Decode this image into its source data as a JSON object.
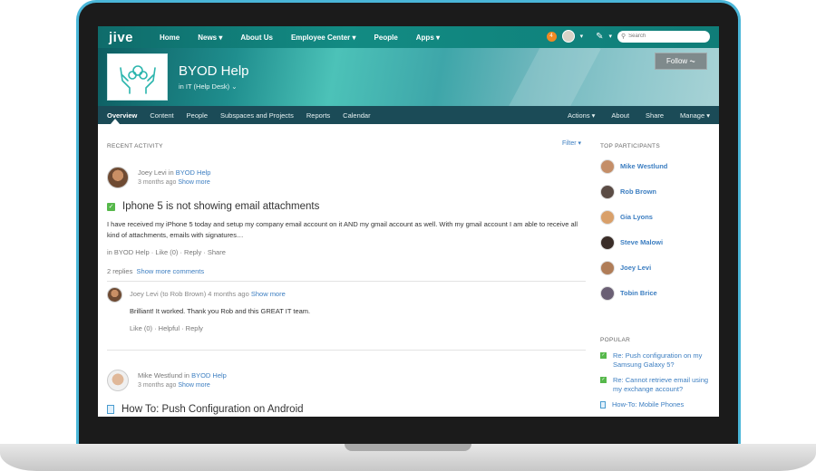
{
  "topnav": {
    "logo": "jive",
    "links": [
      "Home",
      "News ▾",
      "About Us",
      "Employee Center ▾",
      "People",
      "Apps ▾"
    ],
    "notification_count": "4",
    "search_placeholder": "Search"
  },
  "place": {
    "title": "BYOD Help",
    "subtitle": "in IT (Help Desk) ⌄",
    "follow_label": "Follow ⏦"
  },
  "subnav": {
    "tabs": [
      "Overview",
      "Content",
      "People",
      "Subspaces and Projects",
      "Reports",
      "Calendar"
    ],
    "right": [
      "Actions ▾",
      "About",
      "Share",
      "Manage ▾"
    ]
  },
  "activity": {
    "heading": "RECENT ACTIVITY",
    "filter": "Filter ▾",
    "post1": {
      "author": "Joey Levi",
      "in_word": " in ",
      "place": "BYOD Help",
      "time": "3 months ago",
      "show_more": "Show more",
      "title": "Iphone 5 is not showing email attachments",
      "body": "I have received my iPhone 5 today and setup my company email account on it AND my gmail account as well.   With my gmail account I am able to receive all kind of attachments, emails with signatures…",
      "actions_prefix": "in ",
      "actions_place": "BYOD Help",
      "actions_rest": " · Like (0) · Reply · Share",
      "replies_count": "2 replies",
      "replies_link": "Show more comments"
    },
    "reply": {
      "author": "Joey Levi",
      "to": " (to Rob Brown) ",
      "time": "4 months ago",
      "show_more": "Show more",
      "body": "Brilliant! It worked. Thank you Rob and this GREAT IT team.",
      "actions": "Like (0) · Helpful · Reply"
    },
    "post2": {
      "author": "Mike Westlund",
      "in_word": " in ",
      "place": "BYOD Help",
      "time": "3 months ago",
      "show_more": "Show more",
      "title": "How To: Push Configuration on Android"
    }
  },
  "sidebar": {
    "participants_heading": "TOP PARTICIPANTS",
    "participants": [
      "Mike Westlund",
      "Rob Brown",
      "Gia Lyons",
      "Steve Malowi",
      "Joey Levi",
      "Tobin Brice"
    ],
    "popular_heading": "POPULAR",
    "popular": [
      "Re: Push configuration on my Samsung Galaxy 5?",
      "Re: Cannot retrieve email using my exchange account?",
      "How-To: Mobile Phones"
    ]
  },
  "colors": {
    "accent": "#128b83",
    "link": "#3c7ec1",
    "subnav": "#1b4b57",
    "check": "#56b84b"
  }
}
